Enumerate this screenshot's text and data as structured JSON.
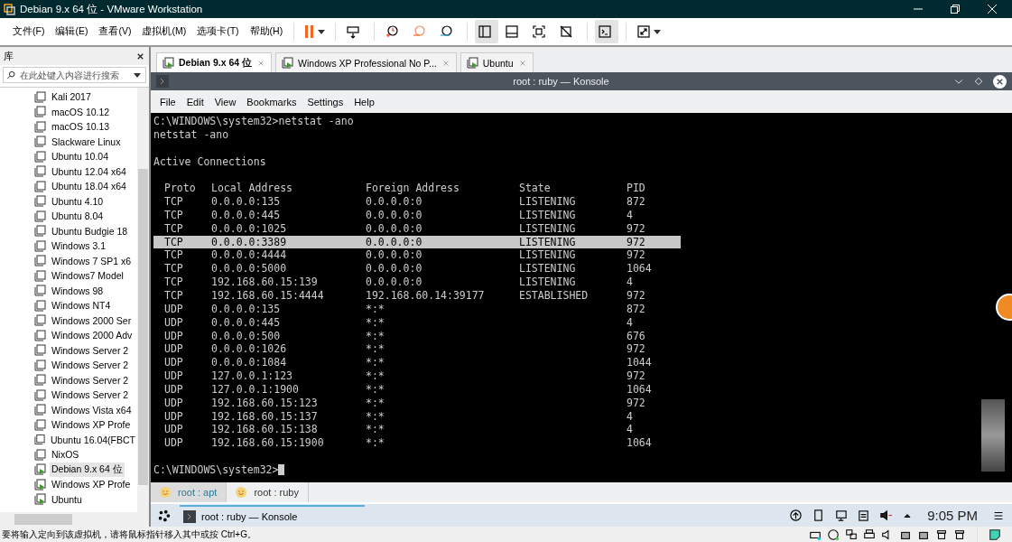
{
  "window": {
    "title": "Debian 9.x 64 位 - VMware Workstation"
  },
  "menu": [
    "文件(F)",
    "编辑(E)",
    "查看(V)",
    "虚拟机(M)",
    "选项卡(T)",
    "帮助(H)"
  ],
  "toolbar": [
    {
      "kind": "pause",
      "selected": false
    },
    {
      "kind": "send",
      "selected": false
    },
    {
      "kind": "snapshot",
      "selected": false
    },
    {
      "kind": "revert",
      "selected": false
    },
    {
      "kind": "manager",
      "selected": false
    },
    {
      "kind": "library",
      "selected": true
    },
    {
      "kind": "thumbs",
      "selected": false
    },
    {
      "kind": "fullscreen",
      "selected": false
    },
    {
      "kind": "unity",
      "selected": false
    },
    {
      "kind": "console",
      "selected": true
    },
    {
      "kind": "stretch",
      "selected": false
    }
  ],
  "library": {
    "title": "库",
    "search": {
      "placeholder": "在此处键入内容进行搜索"
    },
    "items": [
      {
        "label": "Kali 2017",
        "running": false,
        "selected": false
      },
      {
        "label": "macOS 10.12",
        "running": false,
        "selected": false
      },
      {
        "label": "macOS 10.13",
        "running": false,
        "selected": false
      },
      {
        "label": "Slackware Linux",
        "running": false,
        "selected": false
      },
      {
        "label": "Ubuntu 10.04",
        "running": false,
        "selected": false
      },
      {
        "label": "Ubuntu 12.04 x64",
        "running": false,
        "selected": false
      },
      {
        "label": "Ubuntu 18.04 x64",
        "running": false,
        "selected": false
      },
      {
        "label": "Ubuntu 4.10",
        "running": false,
        "selected": false
      },
      {
        "label": "Ubuntu 8.04",
        "running": false,
        "selected": false
      },
      {
        "label": "Ubuntu Budgie 18",
        "running": false,
        "selected": false
      },
      {
        "label": "Windows 3.1",
        "running": false,
        "selected": false
      },
      {
        "label": "Windows 7 SP1 x6",
        "running": false,
        "selected": false
      },
      {
        "label": "Windows7 Model",
        "running": false,
        "selected": false
      },
      {
        "label": "Windows 98",
        "running": false,
        "selected": false
      },
      {
        "label": "Windows NT4",
        "running": false,
        "selected": false
      },
      {
        "label": "Windows 2000 Ser",
        "running": false,
        "selected": false
      },
      {
        "label": "Windows 2000 Adv",
        "running": false,
        "selected": false
      },
      {
        "label": "Windows Server 2",
        "running": false,
        "selected": false
      },
      {
        "label": "Windows Server 2",
        "running": false,
        "selected": false
      },
      {
        "label": "Windows Server 2",
        "running": false,
        "selected": false
      },
      {
        "label": "Windows Server 2",
        "running": false,
        "selected": false
      },
      {
        "label": "Windows Vista x64",
        "running": false,
        "selected": false
      },
      {
        "label": "Windows XP Profe",
        "running": false,
        "selected": false
      },
      {
        "label": "Ubuntu 16.04(FBCT",
        "running": false,
        "selected": false
      },
      {
        "label": "NixOS",
        "running": false,
        "selected": false
      },
      {
        "label": "Debian 9.x 64 位",
        "running": true,
        "selected": true
      },
      {
        "label": "Windows XP Profe",
        "running": true,
        "selected": false
      },
      {
        "label": "Ubuntu",
        "running": true,
        "selected": false
      }
    ]
  },
  "vm_tabs": [
    {
      "label": "Debian 9.x 64 位",
      "selected": true
    },
    {
      "label": "Windows XP Professional No P...",
      "selected": false
    },
    {
      "label": "Ubuntu",
      "selected": false
    }
  ],
  "konsole": {
    "title": "root : ruby — Konsole",
    "menu": [
      "File",
      "Edit",
      "View",
      "Bookmarks",
      "Settings",
      "Help"
    ],
    "lines_before": [
      {
        "text": "C:\\WINDOWS\\system32>netstat -ano"
      },
      {
        "text": "netstat -ano"
      },
      {
        "text": "Active Connections",
        "space_before": true
      }
    ],
    "columns": [
      "Proto",
      "Local Address",
      "Foreign Address",
      "State",
      "PID"
    ],
    "rows": [
      {
        "cells": [
          "TCP",
          "0.0.0.0:135",
          "0.0.0.0:0",
          "LISTENING",
          "872"
        ],
        "selected": false
      },
      {
        "cells": [
          "TCP",
          "0.0.0.0:445",
          "0.0.0.0:0",
          "LISTENING",
          "4"
        ],
        "selected": false
      },
      {
        "cells": [
          "TCP",
          "0.0.0.0:1025",
          "0.0.0.0:0",
          "LISTENING",
          "972"
        ],
        "selected": false
      },
      {
        "cells": [
          "TCP",
          "0.0.0.0:3389",
          "0.0.0.0:0",
          "LISTENING",
          "972"
        ],
        "selected": true
      },
      {
        "cells": [
          "TCP",
          "0.0.0.0:4444",
          "0.0.0.0:0",
          "LISTENING",
          "972"
        ],
        "selected": false
      },
      {
        "cells": [
          "TCP",
          "0.0.0.0:5000",
          "0.0.0.0:0",
          "LISTENING",
          "1064"
        ],
        "selected": false
      },
      {
        "cells": [
          "TCP",
          "192.168.60.15:139",
          "0.0.0.0:0",
          "LISTENING",
          "4"
        ],
        "selected": false
      },
      {
        "cells": [
          "TCP",
          "192.168.60.15:4444",
          "192.168.60.14:39177",
          "ESTABLISHED",
          "972"
        ],
        "selected": false
      },
      {
        "cells": [
          "UDP",
          "0.0.0.0:135",
          "*:*",
          "",
          "872"
        ],
        "selected": false
      },
      {
        "cells": [
          "UDP",
          "0.0.0.0:445",
          "*:*",
          "",
          "4"
        ],
        "selected": false
      },
      {
        "cells": [
          "UDP",
          "0.0.0.0:500",
          "*:*",
          "",
          "676"
        ],
        "selected": false
      },
      {
        "cells": [
          "UDP",
          "0.0.0.0:1026",
          "*:*",
          "",
          "972"
        ],
        "selected": false
      },
      {
        "cells": [
          "UDP",
          "0.0.0.0:1084",
          "*:*",
          "",
          "1044"
        ],
        "selected": false
      },
      {
        "cells": [
          "UDP",
          "127.0.0.1:123",
          "*:*",
          "",
          "972"
        ],
        "selected": false
      },
      {
        "cells": [
          "UDP",
          "127.0.0.1:1900",
          "*:*",
          "",
          "1064"
        ],
        "selected": false
      },
      {
        "cells": [
          "UDP",
          "192.168.60.15:123",
          "*:*",
          "",
          "972"
        ],
        "selected": false
      },
      {
        "cells": [
          "UDP",
          "192.168.60.15:137",
          "*:*",
          "",
          "4"
        ],
        "selected": false
      },
      {
        "cells": [
          "UDP",
          "192.168.60.15:138",
          "*:*",
          "",
          "4"
        ],
        "selected": false
      },
      {
        "cells": [
          "UDP",
          "192.168.60.15:1900",
          "*:*",
          "",
          "1064"
        ],
        "selected": false
      }
    ],
    "prompt": "C:\\WINDOWS\\system32>",
    "sessions": [
      {
        "label": "root : apt",
        "selected": true
      },
      {
        "label": "root : ruby",
        "selected": false
      }
    ]
  },
  "taskbar": {
    "task": "root : ruby — Konsole",
    "clock": "9:05 PM"
  },
  "status_bar": {
    "message": "要将输入定向到该虚拟机，请将鼠标指针移入其中或按 Ctrl+G。"
  }
}
